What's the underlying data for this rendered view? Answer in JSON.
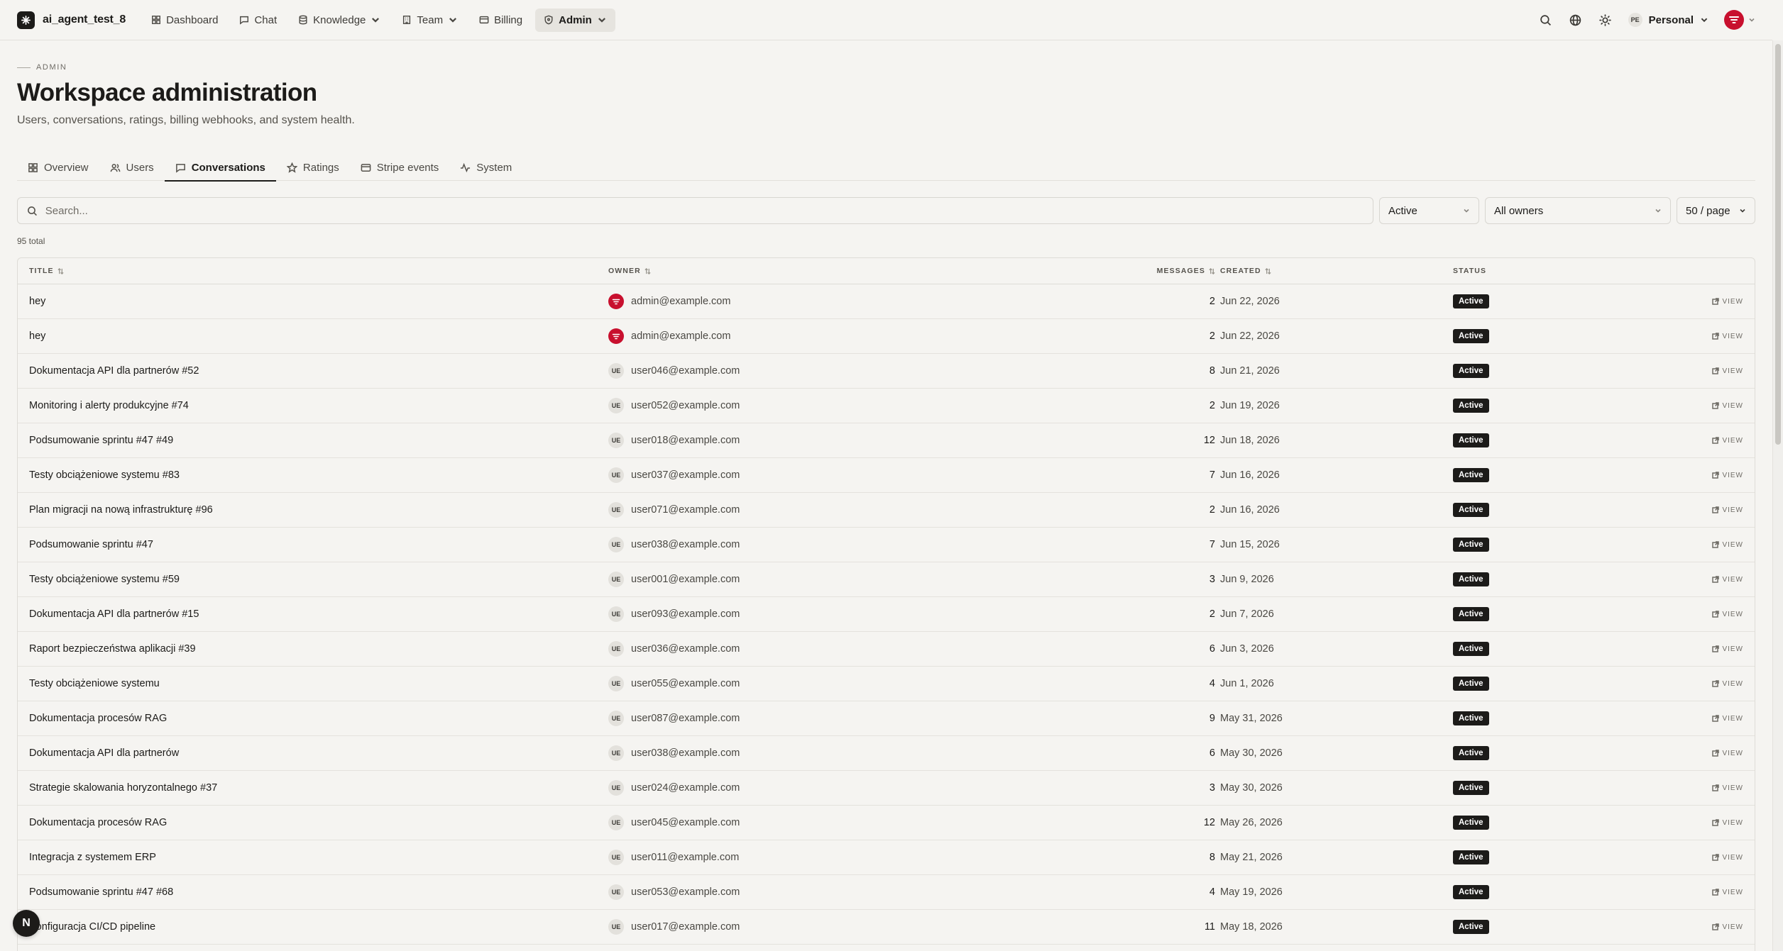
{
  "app": {
    "name": "ai_agent_test_8"
  },
  "nav": [
    {
      "label": "Dashboard",
      "icon": "grid-icon",
      "has_menu": false,
      "active": false
    },
    {
      "label": "Chat",
      "icon": "chat-icon",
      "has_menu": false,
      "active": false
    },
    {
      "label": "Knowledge",
      "icon": "database-icon",
      "has_menu": true,
      "active": false
    },
    {
      "label": "Team",
      "icon": "building-icon",
      "has_menu": true,
      "active": false
    },
    {
      "label": "Billing",
      "icon": "card-icon",
      "has_menu": false,
      "active": false
    },
    {
      "label": "Admin",
      "icon": "shield-icon",
      "has_menu": true,
      "active": true
    }
  ],
  "workspace": {
    "badge": "PE",
    "label": "Personal"
  },
  "header": {
    "eyebrow": "ADMIN",
    "title": "Workspace administration",
    "subtitle": "Users, conversations, ratings, billing webhooks, and system health."
  },
  "tabs": [
    {
      "label": "Overview",
      "icon": "grid-icon",
      "active": false
    },
    {
      "label": "Users",
      "icon": "users-icon",
      "active": false
    },
    {
      "label": "Conversations",
      "icon": "chat-icon",
      "active": true
    },
    {
      "label": "Ratings",
      "icon": "star-icon",
      "active": false
    },
    {
      "label": "Stripe events",
      "icon": "card-icon",
      "active": false
    },
    {
      "label": "System",
      "icon": "activity-icon",
      "active": false
    }
  ],
  "filters": {
    "search_placeholder": "Search...",
    "status_value": "Active",
    "owner_value": "All owners",
    "page_size_value": "50 / page"
  },
  "total_label": "95 total",
  "table": {
    "columns": {
      "title": "TITLE",
      "owner": "OWNER",
      "messages": "MESSAGES",
      "created": "CREATED",
      "status": "STATUS"
    },
    "view_label": "VIEW",
    "rows": [
      {
        "title": "hey",
        "owner": "admin@example.com",
        "avatar": "brand",
        "messages": "2",
        "created": "Jun 22, 2026",
        "status": "Active"
      },
      {
        "title": "hey",
        "owner": "admin@example.com",
        "avatar": "brand",
        "messages": "2",
        "created": "Jun 22, 2026",
        "status": "Active"
      },
      {
        "title": "Dokumentacja API dla partnerów #52",
        "owner": "user046@example.com",
        "avatar": "UE",
        "messages": "8",
        "created": "Jun 21, 2026",
        "status": "Active"
      },
      {
        "title": "Monitoring i alerty produkcyjne #74",
        "owner": "user052@example.com",
        "avatar": "UE",
        "messages": "2",
        "created": "Jun 19, 2026",
        "status": "Active"
      },
      {
        "title": "Podsumowanie sprintu #47 #49",
        "owner": "user018@example.com",
        "avatar": "UE",
        "messages": "12",
        "created": "Jun 18, 2026",
        "status": "Active"
      },
      {
        "title": "Testy obciążeniowe systemu #83",
        "owner": "user037@example.com",
        "avatar": "UE",
        "messages": "7",
        "created": "Jun 16, 2026",
        "status": "Active"
      },
      {
        "title": "Plan migracji na nową infrastrukturę #96",
        "owner": "user071@example.com",
        "avatar": "UE",
        "messages": "2",
        "created": "Jun 16, 2026",
        "status": "Active"
      },
      {
        "title": "Podsumowanie sprintu #47",
        "owner": "user038@example.com",
        "avatar": "UE",
        "messages": "7",
        "created": "Jun 15, 2026",
        "status": "Active"
      },
      {
        "title": "Testy obciążeniowe systemu #59",
        "owner": "user001@example.com",
        "avatar": "UE",
        "messages": "3",
        "created": "Jun 9, 2026",
        "status": "Active"
      },
      {
        "title": "Dokumentacja API dla partnerów #15",
        "owner": "user093@example.com",
        "avatar": "UE",
        "messages": "2",
        "created": "Jun 7, 2026",
        "status": "Active"
      },
      {
        "title": "Raport bezpieczeństwa aplikacji #39",
        "owner": "user036@example.com",
        "avatar": "UE",
        "messages": "6",
        "created": "Jun 3, 2026",
        "status": "Active"
      },
      {
        "title": "Testy obciążeniowe systemu",
        "owner": "user055@example.com",
        "avatar": "UE",
        "messages": "4",
        "created": "Jun 1, 2026",
        "status": "Active"
      },
      {
        "title": "Dokumentacja procesów RAG",
        "owner": "user087@example.com",
        "avatar": "UE",
        "messages": "9",
        "created": "May 31, 2026",
        "status": "Active"
      },
      {
        "title": "Dokumentacja API dla partnerów",
        "owner": "user038@example.com",
        "avatar": "UE",
        "messages": "6",
        "created": "May 30, 2026",
        "status": "Active"
      },
      {
        "title": "Strategie skalowania horyzontalnego #37",
        "owner": "user024@example.com",
        "avatar": "UE",
        "messages": "3",
        "created": "May 30, 2026",
        "status": "Active"
      },
      {
        "title": "Dokumentacja procesów RAG",
        "owner": "user045@example.com",
        "avatar": "UE",
        "messages": "12",
        "created": "May 26, 2026",
        "status": "Active"
      },
      {
        "title": "Integracja z systemem ERP",
        "owner": "user011@example.com",
        "avatar": "UE",
        "messages": "8",
        "created": "May 21, 2026",
        "status": "Active"
      },
      {
        "title": "Podsumowanie sprintu #47 #68",
        "owner": "user053@example.com",
        "avatar": "UE",
        "messages": "4",
        "created": "May 19, 2026",
        "status": "Active"
      },
      {
        "title": "Konfiguracja CI/CD pipeline",
        "owner": "user017@example.com",
        "avatar": "UE",
        "messages": "11",
        "created": "May 18, 2026",
        "status": "Active"
      }
    ]
  },
  "fab_label": "N",
  "colors": {
    "background": "#f5f4f1",
    "ink": "#1c1b19",
    "brand_red": "#c8102e"
  }
}
